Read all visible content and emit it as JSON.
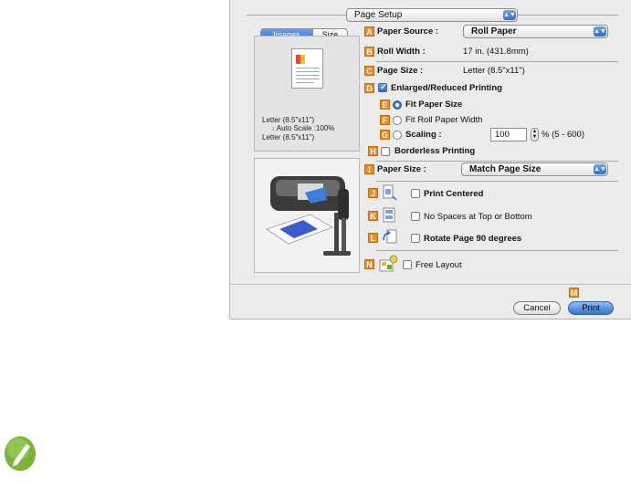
{
  "dialog": {
    "header_popup": "Page Setup",
    "tabs": [
      "Images",
      "Size"
    ],
    "preview": {
      "source_size": "Letter (8.5\"x11\")",
      "scale_text": "Auto Scale :100%",
      "output_size": "Letter (8.5\"x11\")"
    },
    "markers": {
      "a": "A",
      "b": "B",
      "c": "C",
      "d": "D",
      "e": "E",
      "f": "F",
      "g": "G",
      "h": "H",
      "i": "I",
      "j": "J",
      "k": "K",
      "l": "L",
      "m": "M",
      "n": "N"
    },
    "paper_source": {
      "label": "Paper Source :",
      "value": "Roll Paper"
    },
    "roll_width": {
      "label": "Roll Width :",
      "value": "17 in. (431.8mm)"
    },
    "page_size": {
      "label": "Page Size :",
      "value": "Letter (8.5\"x11\")"
    },
    "enlarged_reduced": {
      "label": "Enlarged/Reduced Printing",
      "checked": true
    },
    "fit_paper_size": {
      "label": "Fit Paper Size",
      "selected": true
    },
    "fit_roll_width": {
      "label": "Fit Roll Paper Width",
      "selected": false
    },
    "scaling": {
      "label": "Scaling :",
      "value": "100",
      "range": "% (5 - 600)",
      "selected": false
    },
    "borderless": {
      "label": "Borderless Printing",
      "checked": false
    },
    "paper_size": {
      "label": "Paper Size :",
      "value": "Match Page Size"
    },
    "print_centered": {
      "label": "Print Centered",
      "checked": false
    },
    "no_spaces": {
      "label": "No Spaces at Top or Bottom",
      "checked": false
    },
    "rotate": {
      "label": "Rotate Page 90 degrees",
      "checked": false
    },
    "free_layout": {
      "label": "Free Layout",
      "checked": false
    },
    "cancel_label": "Cancel",
    "print_label": "Print"
  },
  "colors": {
    "marker": "#f08a1c",
    "accent": "#2e6bc9"
  }
}
